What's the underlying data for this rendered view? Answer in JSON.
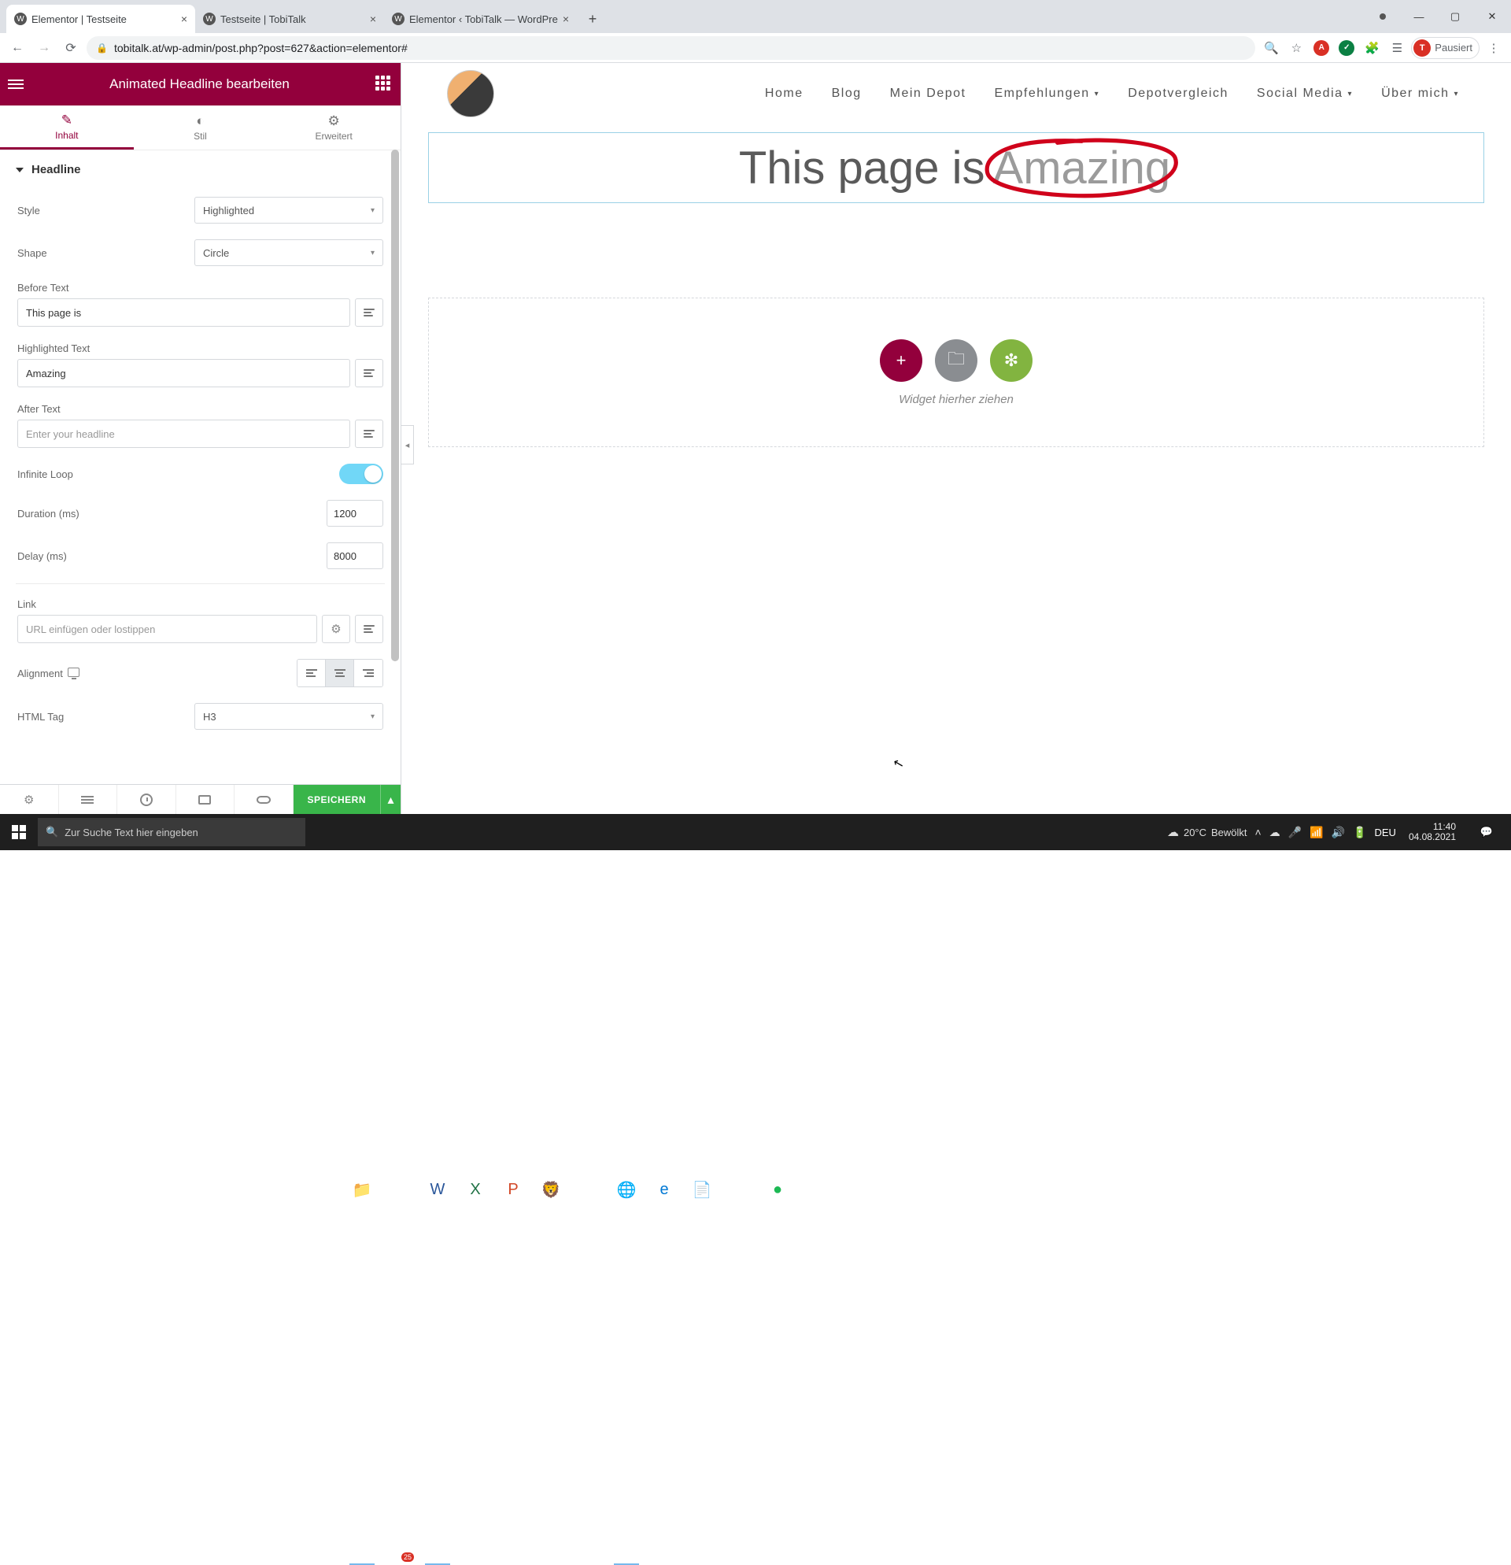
{
  "browser": {
    "tabs": [
      {
        "title": "Elementor | Testseite",
        "active": true
      },
      {
        "title": "Testseite | TobiTalk",
        "active": false
      },
      {
        "title": "Elementor ‹ TobiTalk — WordPre",
        "active": false
      }
    ],
    "url": "tobitalk.at/wp-admin/post.php?post=627&action=elementor#",
    "profile_label": "Pausiert",
    "profile_initial": "T"
  },
  "sidebar": {
    "title": "Animated Headline bearbeiten",
    "tabs": {
      "content": "Inhalt",
      "style": "Stil",
      "advanced": "Erweitert"
    },
    "accordion_title": "Headline",
    "fields": {
      "style_label": "Style",
      "style_value": "Highlighted",
      "shape_label": "Shape",
      "shape_value": "Circle",
      "before_label": "Before Text",
      "before_value": "This page is",
      "highlighted_label": "Highlighted Text",
      "highlighted_value": "Amazing",
      "after_label": "After Text",
      "after_placeholder": "Enter your headline",
      "loop_label": "Infinite Loop",
      "duration_label": "Duration (ms)",
      "duration_value": "1200",
      "delay_label": "Delay (ms)",
      "delay_value": "8000",
      "link_label": "Link",
      "link_placeholder": "URL einfügen oder lostippen",
      "alignment_label": "Alignment",
      "htmltag_label": "HTML Tag",
      "htmltag_value": "H3"
    },
    "save_label": "SPEICHERN"
  },
  "site": {
    "nav": {
      "home": "Home",
      "blog": "Blog",
      "depot": "Mein Depot",
      "recommend": "Empfehlungen",
      "compare": "Depotvergleich",
      "social": "Social Media",
      "about": "Über mich"
    },
    "headline_before": "This page is",
    "headline_word": "Amazing",
    "dropzone_label": "Widget hierher ziehen"
  },
  "taskbar": {
    "search_placeholder": "Zur Suche Text hier eingeben",
    "mail_count": "25",
    "weather_temp": "20°C",
    "weather_desc": "Bewölkt",
    "lang": "DEU",
    "time": "11:40",
    "date": "04.08.2021"
  }
}
